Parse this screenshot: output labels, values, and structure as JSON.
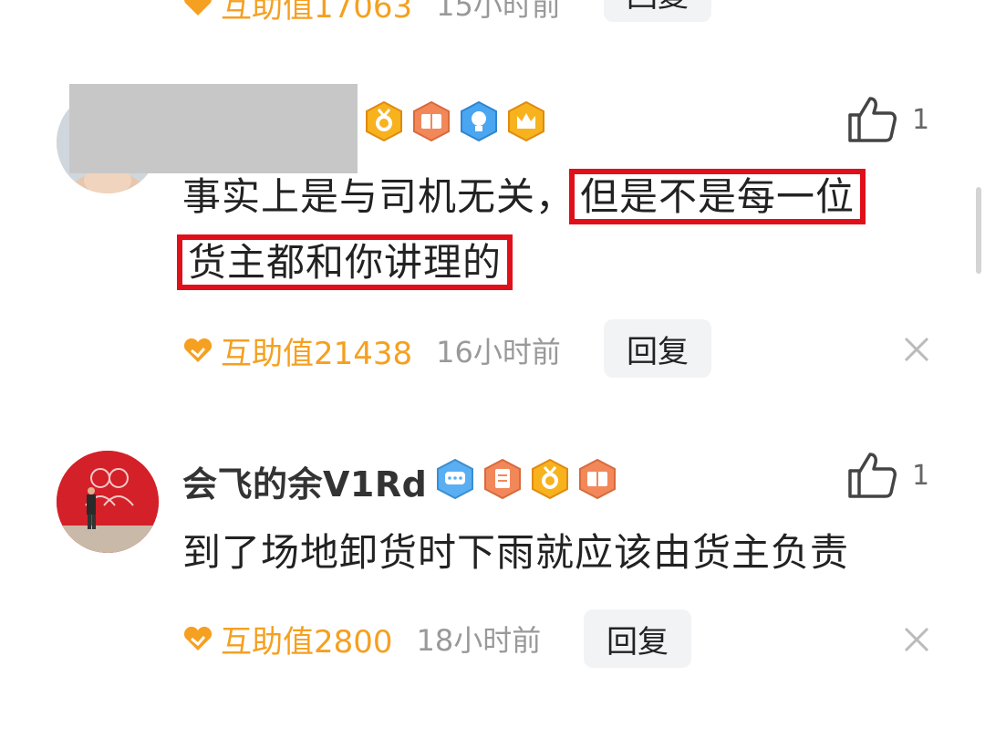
{
  "partial_row": {
    "help_value": "互助值17063",
    "time": "15小时前",
    "reply_label": "回复"
  },
  "comments": [
    {
      "username": "",
      "username_redacted": true,
      "badges": [
        "medal-badge",
        "book-badge",
        "lightbulb-badge",
        "crown-badge"
      ],
      "likes": "1",
      "content_plain": "事实上是与司机无关，",
      "content_highlight_1": "但是不是每一位",
      "content_highlight_2": "货主都和你讲理的",
      "help_value": "互助值21438",
      "time": "16小时前",
      "reply_label": "回复"
    },
    {
      "username": "会飞的余V1Rd",
      "badges": [
        "chat-badge",
        "doc-badge",
        "medal-badge",
        "book-badge"
      ],
      "likes": "1",
      "content": "到了场地卸货时下雨就应该由货主负责",
      "help_value": "互助值2800",
      "time": "18小时前",
      "reply_label": "回复"
    }
  ],
  "colors": {
    "accent_orange": "#f5a020",
    "highlight_red": "#e0101a",
    "muted_gray": "#999999"
  }
}
